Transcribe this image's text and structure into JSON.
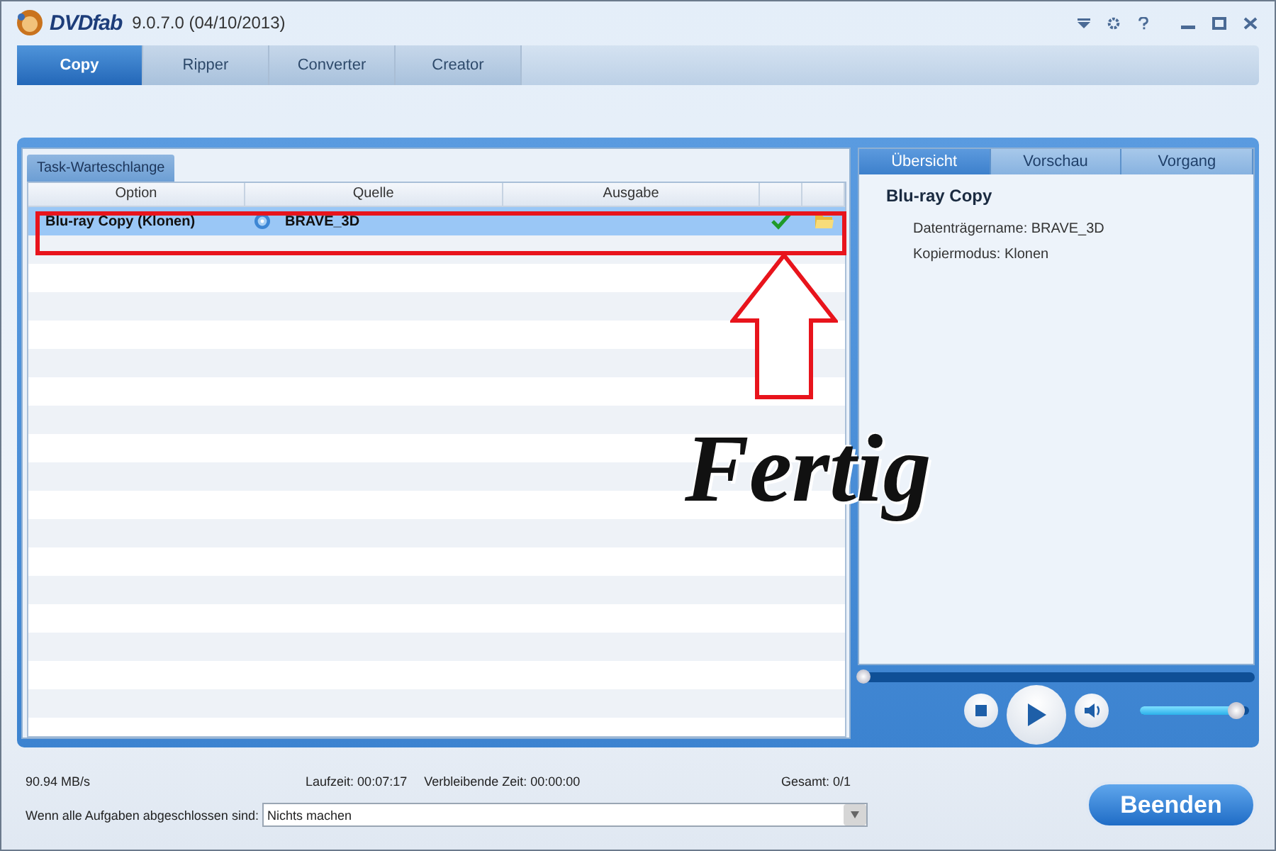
{
  "window": {
    "logo": "DVDfab",
    "version": "9.0.7.0 (04/10/2013)"
  },
  "tabs": [
    {
      "label": "Copy",
      "selected": true
    },
    {
      "label": "Ripper",
      "selected": false
    },
    {
      "label": "Converter",
      "selected": false
    },
    {
      "label": "Creator",
      "selected": false
    }
  ],
  "queue": {
    "tab": "Task-Warteschlange",
    "columns": [
      "Option",
      "Quelle",
      "Ausgabe"
    ],
    "rows": [
      {
        "option": "Blu-ray Copy (Klonen)",
        "source": "BRAVE_3D",
        "selected": true,
        "completed": true
      }
    ]
  },
  "details": {
    "tabs": [
      {
        "label": "Übersicht",
        "selected": true
      },
      {
        "label": "Vorschau",
        "selected": false
      },
      {
        "label": "Vorgang",
        "selected": false
      }
    ],
    "title": "Blu-ray Copy",
    "lines": [
      "Datenträgername: BRAVE_3D",
      "Kopiermodus: Klonen"
    ]
  },
  "player": {
    "seek": {
      "level": 0
    },
    "volume": {
      "level": 0.88
    }
  },
  "status": {
    "speed": "90.94 MB/s",
    "elapsed": "Laufzeit: 00:07:17",
    "remaining": "Verbleibende Zeit: 00:00:00",
    "total": "Gesamt: 0/1"
  },
  "after": {
    "label": "Wenn alle Aufgaben abgeschlossen sind:",
    "value": "Nichts machen"
  },
  "button": "Beenden",
  "annotation": {
    "label": "Fertig"
  }
}
